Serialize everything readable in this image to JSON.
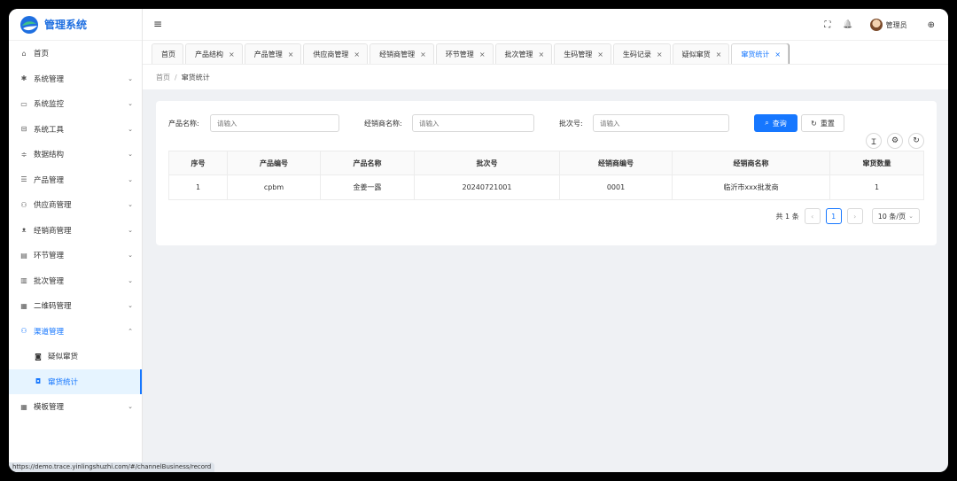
{
  "app": {
    "title": "管理系统"
  },
  "sidebar": {
    "items": [
      {
        "label": "首页",
        "icon": "home-icon",
        "glyph": "⌂",
        "chev": ""
      },
      {
        "label": "系统管理",
        "icon": "gear-icon",
        "glyph": "✱",
        "chev": "⌄"
      },
      {
        "label": "系统监控",
        "icon": "monitor-icon",
        "glyph": "▭",
        "chev": "⌄"
      },
      {
        "label": "系统工具",
        "icon": "toolbox-icon",
        "glyph": "⊟",
        "chev": "⌄"
      },
      {
        "label": "数据结构",
        "icon": "sliders-icon",
        "glyph": "≑",
        "chev": "⌄"
      },
      {
        "label": "产品管理",
        "icon": "list-icon",
        "glyph": "☰",
        "chev": "⌄"
      },
      {
        "label": "供应商管理",
        "icon": "users-icon",
        "glyph": "⚇",
        "chev": "⌄"
      },
      {
        "label": "经销商管理",
        "icon": "dealer-icon",
        "glyph": "ᴥ",
        "chev": "⌄"
      },
      {
        "label": "环节管理",
        "icon": "doc-icon",
        "glyph": "▤",
        "chev": "⌄"
      },
      {
        "label": "批次管理",
        "icon": "barcode-icon",
        "glyph": "▥",
        "chev": "⌄"
      },
      {
        "label": "二维码管理",
        "icon": "qrcode-icon",
        "glyph": "▦",
        "chev": "⌄"
      },
      {
        "label": "渠道管理",
        "icon": "channel-icon",
        "glyph": "⚇",
        "chev": "⌃"
      },
      {
        "label": "疑似窜货",
        "icon": "alert-icon",
        "glyph": "◙",
        "chev": ""
      },
      {
        "label": "窜货统计",
        "icon": "stats-icon",
        "glyph": "◘",
        "chev": ""
      },
      {
        "label": "模板管理",
        "icon": "template-icon",
        "glyph": "▦",
        "chev": "⌄"
      }
    ]
  },
  "header": {
    "menu_icon": "≡",
    "fullscreen": "⛶",
    "bell": "🔔",
    "user": "管理员",
    "globe": "⊕"
  },
  "tabs": [
    {
      "label": "首页",
      "close": ""
    },
    {
      "label": "产品结构",
      "close": "×"
    },
    {
      "label": "产品管理",
      "close": "×"
    },
    {
      "label": "供应商管理",
      "close": "×"
    },
    {
      "label": "经销商管理",
      "close": "×"
    },
    {
      "label": "环节管理",
      "close": "×"
    },
    {
      "label": "批次管理",
      "close": "×"
    },
    {
      "label": "生码管理",
      "close": "×"
    },
    {
      "label": "生码记录",
      "close": "×"
    },
    {
      "label": "疑似窜货",
      "close": "×"
    },
    {
      "label": "窜货统计",
      "close": "×"
    }
  ],
  "breadcrumb": {
    "home": "首页",
    "sep": "/",
    "current": "窜货统计"
  },
  "filters": {
    "product_name_label": "产品名称:",
    "product_name_placeholder": "请输入",
    "dealer_name_label": "经销商名称:",
    "dealer_name_placeholder": "请输入",
    "batch_label": "批次号:",
    "batch_placeholder": "请输入",
    "search_label": "查询",
    "reset_label": "重置"
  },
  "tools": {
    "density": "Ɪ",
    "settings": "⚙",
    "refresh": "↻"
  },
  "table": {
    "columns": [
      "序号",
      "产品编号",
      "产品名称",
      "批次号",
      "经销商编号",
      "经销商名称",
      "窜货数量"
    ],
    "rows": [
      [
        "1",
        "cpbm",
        "金姜一露",
        "20240721001",
        "0001",
        "临沂市xxx批发商",
        "1"
      ]
    ]
  },
  "pagination": {
    "total": "共 1 条",
    "prev": "‹",
    "page": "1",
    "next": "›",
    "size": "10 条/页",
    "size_chev": "⌄"
  },
  "status_url": "https://demo.trace.yinlingshuzhi.com/#/channelBusiness/record"
}
